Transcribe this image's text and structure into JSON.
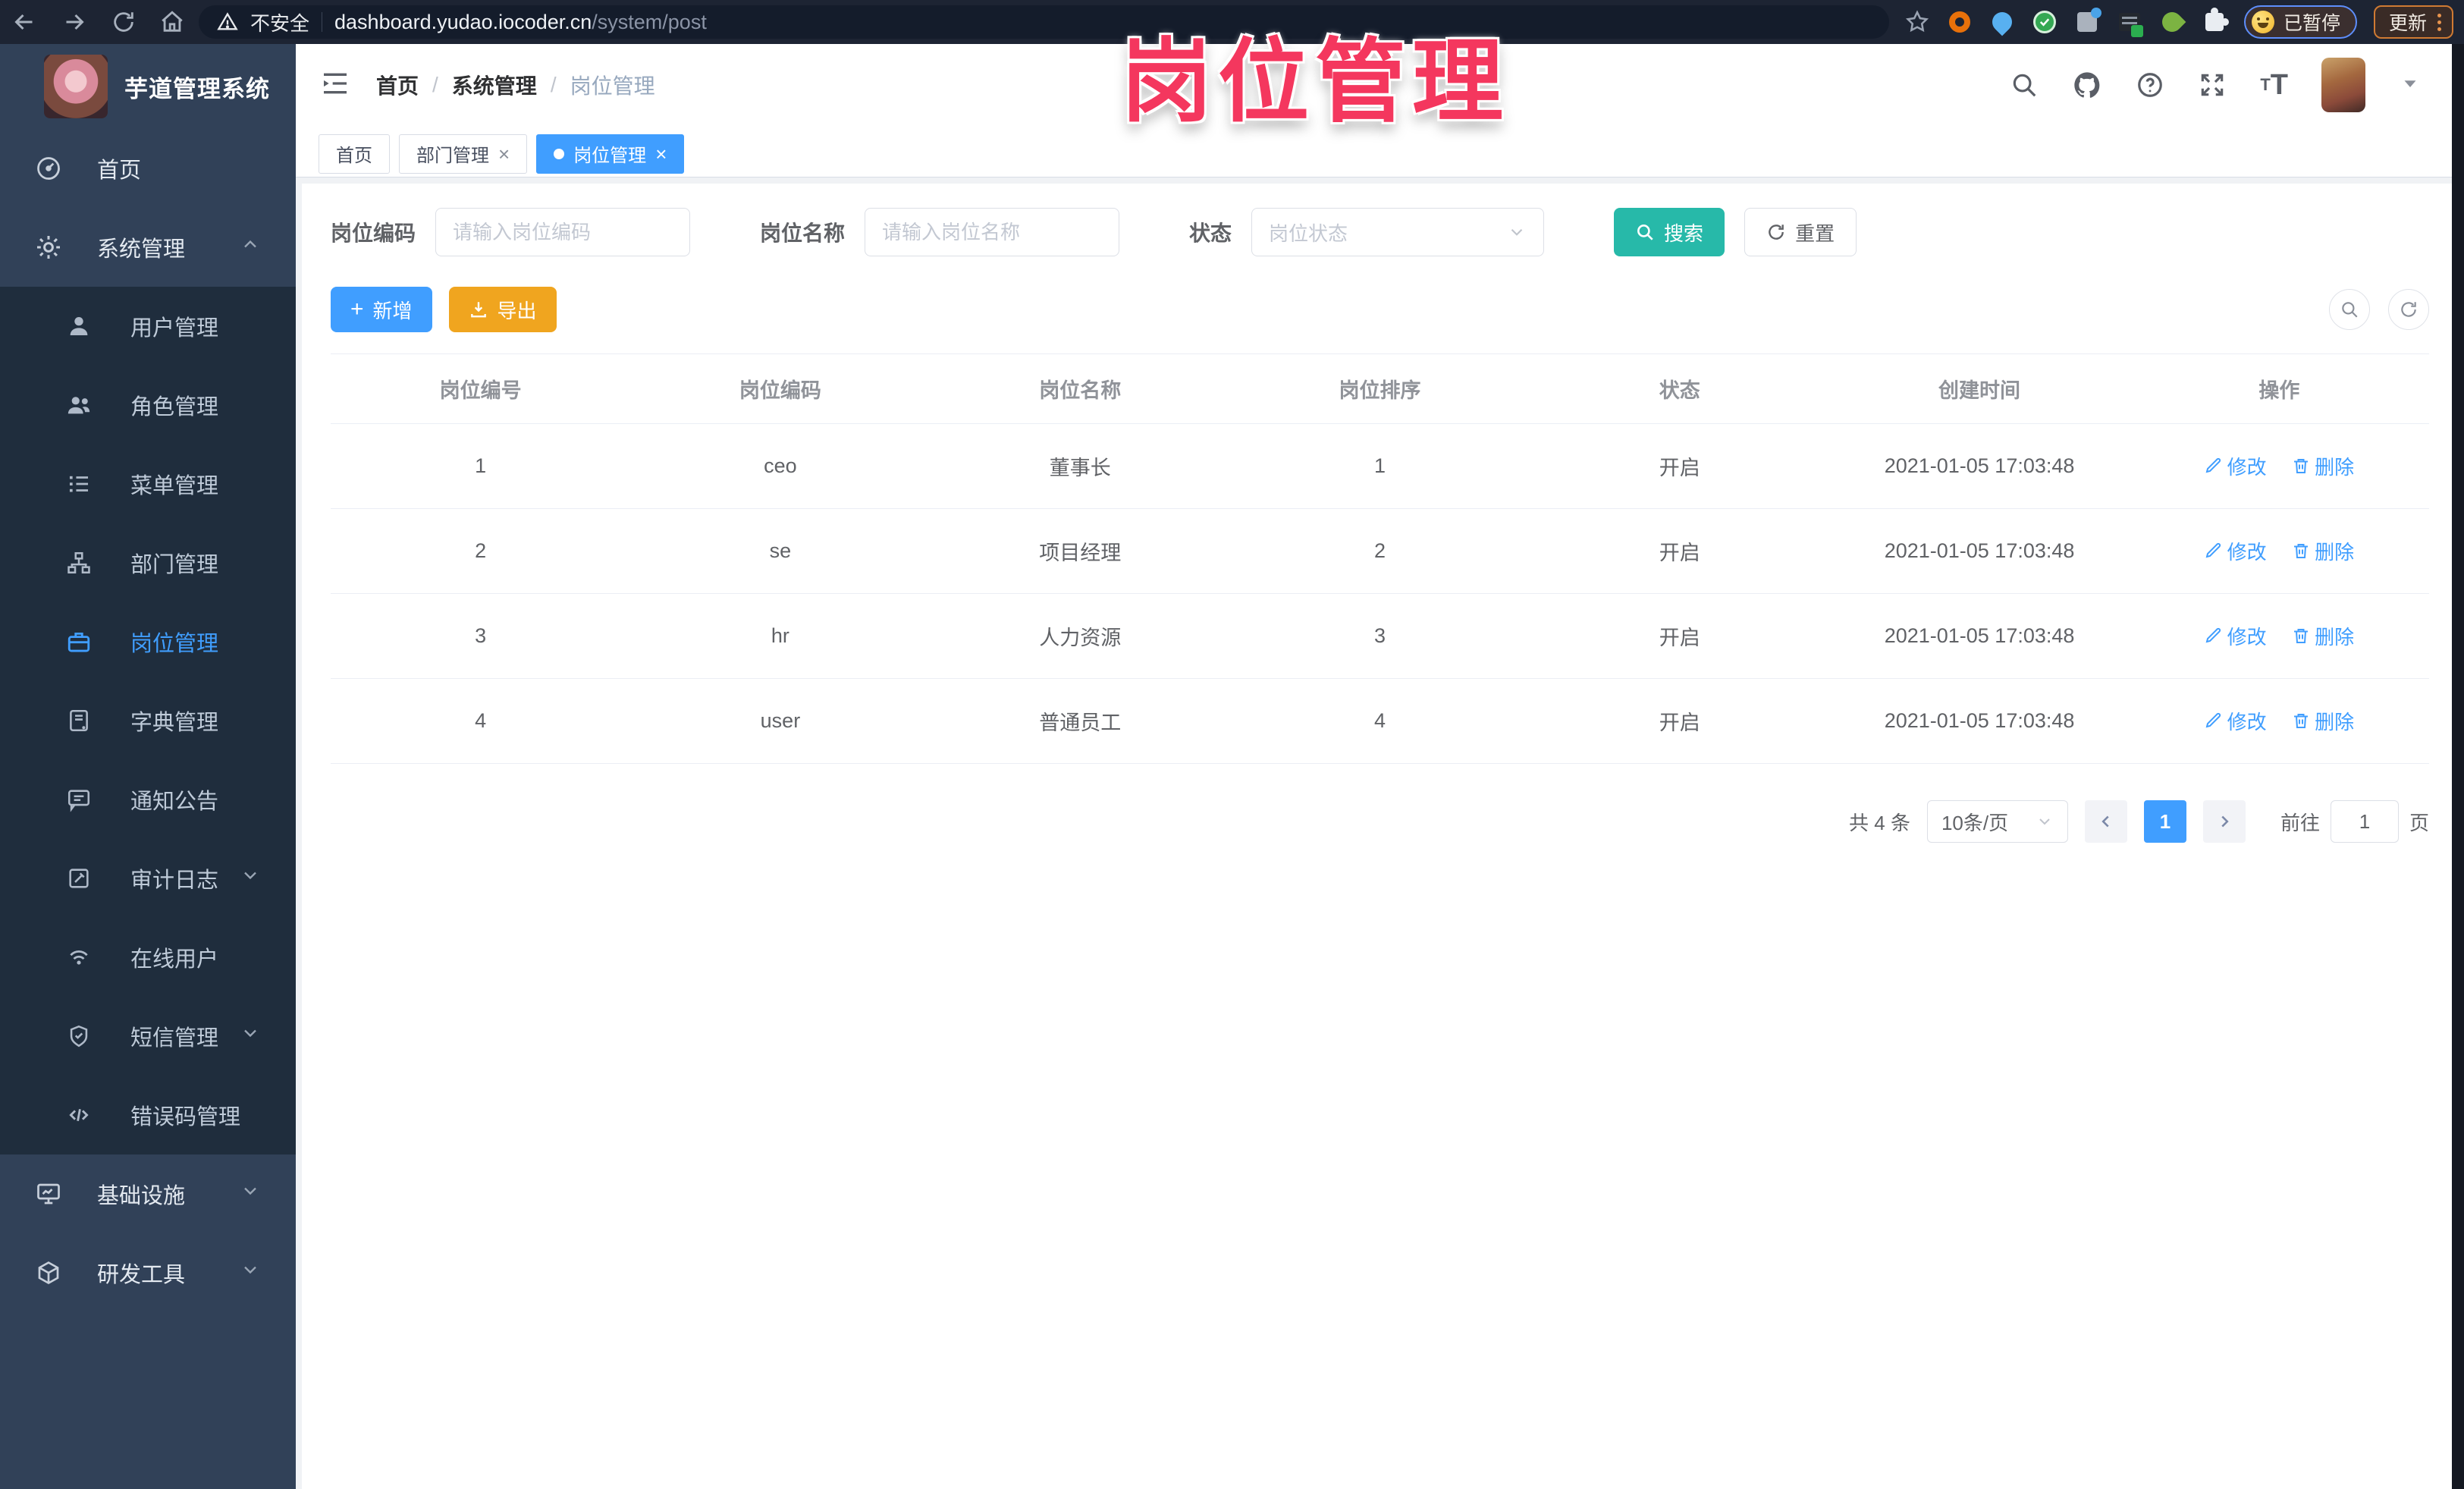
{
  "browser": {
    "security_warning": "不安全",
    "url_domain": "dashboard.yudao.iocoder.cn",
    "url_path": "/system/post",
    "paused_badge": "已暂停",
    "update_button": "更新"
  },
  "overlay_title": "岗位管理",
  "colors": {
    "accent": "#409eff",
    "search_button": "#27b9a9",
    "export_button": "#f0a51f",
    "overlay_title": "#f4375e",
    "sidebar_bg": "#314158",
    "submenu_bg": "#1f2d3d",
    "chrome_bg": "#1d2433"
  },
  "sidebar": {
    "app_title": "芋道管理系统",
    "menu": [
      {
        "label": "首页",
        "icon": "home-icon"
      },
      {
        "label": "系统管理",
        "icon": "gear-icon",
        "state": "expanded"
      },
      {
        "label": "用户管理",
        "icon": "user-icon"
      },
      {
        "label": "角色管理",
        "icon": "users-icon"
      },
      {
        "label": "菜单管理",
        "icon": "menu-list-icon"
      },
      {
        "label": "部门管理",
        "icon": "org-tree-icon"
      },
      {
        "label": "岗位管理",
        "icon": "briefcase-icon",
        "state": "active"
      },
      {
        "label": "字典管理",
        "icon": "dictionary-icon"
      },
      {
        "label": "通知公告",
        "icon": "announcement-icon"
      },
      {
        "label": "审计日志",
        "icon": "audit-log-icon",
        "state": "collapsed"
      },
      {
        "label": "在线用户",
        "icon": "online-user-icon"
      },
      {
        "label": "短信管理",
        "icon": "sms-shield-icon",
        "state": "collapsed"
      },
      {
        "label": "错误码管理",
        "icon": "error-code-icon"
      },
      {
        "label": "基础设施",
        "icon": "infrastructure-icon",
        "state": "collapsed"
      },
      {
        "label": "研发工具",
        "icon": "devtools-icon",
        "state": "collapsed"
      }
    ]
  },
  "breadcrumb": {
    "items": [
      "首页",
      "系统管理",
      "岗位管理"
    ]
  },
  "tabs": [
    {
      "label": "首页"
    },
    {
      "label": "部门管理",
      "closable": true
    },
    {
      "label": "岗位管理",
      "closable": true,
      "active": true
    }
  ],
  "filter": {
    "code_label": "岗位编码",
    "code_placeholder": "请输入岗位编码",
    "name_label": "岗位名称",
    "name_placeholder": "请输入岗位名称",
    "status_label": "状态",
    "status_placeholder": "岗位状态",
    "search_label": "搜索",
    "reset_label": "重置"
  },
  "toolbar": {
    "add_label": "新增",
    "export_label": "导出"
  },
  "table": {
    "columns": [
      "岗位编号",
      "岗位编码",
      "岗位名称",
      "岗位排序",
      "状态",
      "创建时间",
      "操作"
    ],
    "edit_label": "修改",
    "delete_label": "删除",
    "rows": [
      {
        "id": "1",
        "code": "ceo",
        "name": "董事长",
        "sort": "1",
        "status": "开启",
        "created": "2021-01-05 17:03:48"
      },
      {
        "id": "2",
        "code": "se",
        "name": "项目经理",
        "sort": "2",
        "status": "开启",
        "created": "2021-01-05 17:03:48"
      },
      {
        "id": "3",
        "code": "hr",
        "name": "人力资源",
        "sort": "3",
        "status": "开启",
        "created": "2021-01-05 17:03:48"
      },
      {
        "id": "4",
        "code": "user",
        "name": "普通员工",
        "sort": "4",
        "status": "开启",
        "created": "2021-01-05 17:03:48"
      }
    ]
  },
  "pagination": {
    "total": "共 4 条",
    "page_size": "10条/页",
    "current_page": "1",
    "goto_label": "前往",
    "goto_value": "1",
    "page_suffix": "页"
  }
}
